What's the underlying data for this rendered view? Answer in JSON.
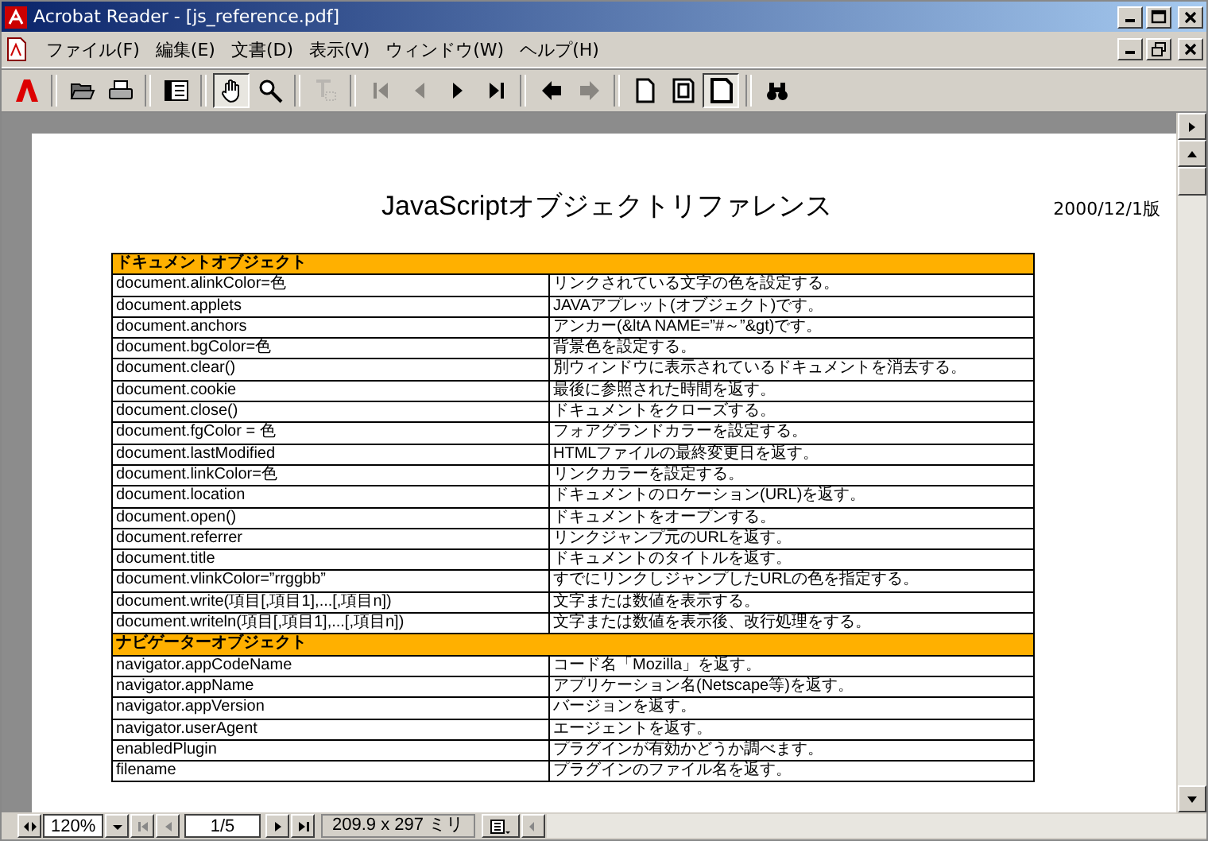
{
  "window": {
    "title": "Acrobat Reader - [js_reference.pdf]"
  },
  "menu": [
    "ファイル(F)",
    "編集(E)",
    "文書(D)",
    "表示(V)",
    "ウィンドウ(W)",
    "ヘルプ(H)"
  ],
  "toolbar": [
    {
      "kind": "logo",
      "selected": false,
      "disabled": false
    },
    {
      "kind": "sep"
    },
    {
      "kind": "open",
      "selected": false,
      "disabled": false
    },
    {
      "kind": "print",
      "selected": false,
      "disabled": false
    },
    {
      "kind": "sep"
    },
    {
      "kind": "panel",
      "selected": false,
      "disabled": false
    },
    {
      "kind": "sep"
    },
    {
      "kind": "hand",
      "selected": true,
      "disabled": false
    },
    {
      "kind": "zoom",
      "selected": false,
      "disabled": false
    },
    {
      "kind": "sep"
    },
    {
      "kind": "text",
      "selected": false,
      "disabled": true
    },
    {
      "kind": "sep"
    },
    {
      "kind": "first",
      "selected": false,
      "disabled": true
    },
    {
      "kind": "prev",
      "selected": false,
      "disabled": true
    },
    {
      "kind": "next",
      "selected": false,
      "disabled": false
    },
    {
      "kind": "last",
      "selected": false,
      "disabled": false
    },
    {
      "kind": "sep"
    },
    {
      "kind": "back",
      "selected": false,
      "disabled": false
    },
    {
      "kind": "forward",
      "selected": false,
      "disabled": true
    },
    {
      "kind": "sep"
    },
    {
      "kind": "page",
      "selected": false,
      "disabled": false
    },
    {
      "kind": "fitpage",
      "selected": false,
      "disabled": false
    },
    {
      "kind": "fitwidth",
      "selected": true,
      "disabled": false
    },
    {
      "kind": "sep"
    },
    {
      "kind": "find",
      "selected": false,
      "disabled": false
    }
  ],
  "document": {
    "title": "JavaScriptオブジェクトリファレンス",
    "date": "2000/12/1版",
    "table": [
      {
        "kind": "header",
        "text": "ドキュメントオブジェクト"
      },
      {
        "kind": "row",
        "name": "document.alinkColor=色",
        "description": "リンクされている文字の色を設定する。"
      },
      {
        "kind": "row",
        "name": "document.applets",
        "description": "JAVAアプレット(オブジェクト)です。"
      },
      {
        "kind": "row",
        "name": "document.anchors",
        "description": "アンカー(&ltA NAME=”#～”&gt)です。"
      },
      {
        "kind": "row",
        "name": "document.bgColor=色",
        "description": "背景色を設定する。"
      },
      {
        "kind": "row",
        "name": "document.clear()",
        "description": "別ウィンドウに表示されているドキュメントを消去する。"
      },
      {
        "kind": "row",
        "name": "document.cookie",
        "description": "最後に参照された時間を返す。"
      },
      {
        "kind": "row",
        "name": "document.close()",
        "description": "ドキュメントをクローズする。"
      },
      {
        "kind": "row",
        "name": "document.fgColor = 色",
        "description": "フォアグランドカラーを設定する。"
      },
      {
        "kind": "row",
        "name": "document.lastModified",
        "description": "HTMLファイルの最終変更日を返す。"
      },
      {
        "kind": "row",
        "name": "document.linkColor=色",
        "description": "リンクカラーを設定する。"
      },
      {
        "kind": "row",
        "name": "document.location",
        "description": "ドキュメントのロケーション(URL)を返す。"
      },
      {
        "kind": "row",
        "name": "document.open()",
        "description": "ドキュメントをオープンする。"
      },
      {
        "kind": "row",
        "name": "document.referrer",
        "description": "リンクジャンプ元のURLを返す。"
      },
      {
        "kind": "row",
        "name": "document.title",
        "description": "ドキュメントのタイトルを返す。"
      },
      {
        "kind": "row",
        "name": "document.vlinkColor=”rrggbb”",
        "description": "すでにリンクしジャンプしたURLの色を指定する。"
      },
      {
        "kind": "row",
        "name": "document.write(項目[,項目1],...[,項目n])",
        "description": "文字または数値を表示する。"
      },
      {
        "kind": "row",
        "name": "document.writeln(項目[,項目1],...[,項目n])",
        "description": "文字または数値を表示後、改行処理をする。"
      },
      {
        "kind": "header",
        "text": "ナビゲーターオブジェクト"
      },
      {
        "kind": "row",
        "name": "navigator.appCodeName",
        "description": "コード名「Mozilla」を返す。"
      },
      {
        "kind": "row",
        "name": "navigator.appName",
        "description": "アプリケーション名(Netscape等)を返す。"
      },
      {
        "kind": "row",
        "name": "navigator.appVersion",
        "description": "バージョンを返す。"
      },
      {
        "kind": "row",
        "name": "navigator.userAgent",
        "description": "エージェントを返す。"
      },
      {
        "kind": "row",
        "name": "enabledPlugin",
        "description": "プラグインが有効かどうか調べます。"
      },
      {
        "kind": "row",
        "name": "filename",
        "description": "プラグインのファイル名を返す。"
      }
    ]
  },
  "status_bar": {
    "zoom": "120%",
    "page": "1/5",
    "size": "209.9 x 297 ミリ"
  }
}
